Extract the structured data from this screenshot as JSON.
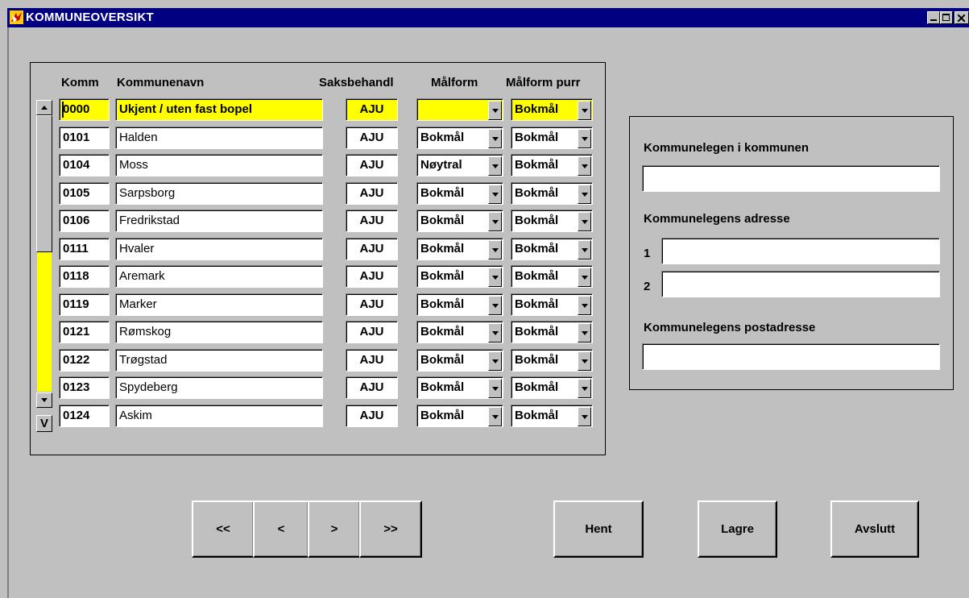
{
  "window": {
    "title": "KOMMUNEOVERSIKT",
    "icon": "app-icon",
    "controls": [
      "minimize-icon",
      "maximize-icon",
      "close-icon"
    ]
  },
  "grid": {
    "headers": {
      "komm": "Komm",
      "kommunenavn": "Kommunenavn",
      "saksbehandl": "Saksbehandl",
      "malform": "Målform",
      "malform_purr": "Målform purr"
    },
    "rows": [
      {
        "komm": "0000",
        "navn": "Ukjent / uten fast bopel",
        "saks": "AJU",
        "malform": "",
        "purr": "Bokmål"
      },
      {
        "komm": "0101",
        "navn": "Halden",
        "saks": "AJU",
        "malform": "Bokmål",
        "purr": "Bokmål"
      },
      {
        "komm": "0104",
        "navn": "Moss",
        "saks": "AJU",
        "malform": "Nøytral",
        "purr": "Bokmål"
      },
      {
        "komm": "0105",
        "navn": "Sarpsborg",
        "saks": "AJU",
        "malform": "Bokmål",
        "purr": "Bokmål"
      },
      {
        "komm": "0106",
        "navn": "Fredrikstad",
        "saks": "AJU",
        "malform": "Bokmål",
        "purr": "Bokmål"
      },
      {
        "komm": "0111",
        "navn": "Hvaler",
        "saks": "AJU",
        "malform": "Bokmål",
        "purr": "Bokmål"
      },
      {
        "komm": "0118",
        "navn": "Aremark",
        "saks": "AJU",
        "malform": "Bokmål",
        "purr": "Bokmål"
      },
      {
        "komm": "0119",
        "navn": "Marker",
        "saks": "AJU",
        "malform": "Bokmål",
        "purr": "Bokmål"
      },
      {
        "komm": "0121",
        "navn": "Rømskog",
        "saks": "AJU",
        "malform": "Bokmål",
        "purr": "Bokmål"
      },
      {
        "komm": "0122",
        "navn": "Trøgstad",
        "saks": "AJU",
        "malform": "Bokmål",
        "purr": "Bokmål"
      },
      {
        "komm": "0123",
        "navn": "Spydeberg",
        "saks": "AJU",
        "malform": "Bokmål",
        "purr": "Bokmål"
      },
      {
        "komm": "0124",
        "navn": "Askim",
        "saks": "AJU",
        "malform": "Bokmål",
        "purr": "Bokmål"
      }
    ],
    "v_button": "V"
  },
  "details": {
    "kommunelege_label": "Kommunelegen i kommunen",
    "kommunelege_value": "",
    "adresse_label": "Kommunelegens adresse",
    "adresse_1_label": "1",
    "adresse_1_value": "",
    "adresse_2_label": "2",
    "adresse_2_value": "",
    "postadresse_label": "Kommunelegens postadresse",
    "postadresse_value": ""
  },
  "nav": {
    "first": "<<",
    "prev": "<",
    "next": ">",
    "last": ">>"
  },
  "actions": {
    "hent": "Hent",
    "lagre": "Lagre",
    "avslutt": "Avslutt"
  },
  "colors": {
    "titlebar": "#000080",
    "current_record": "#ffff00",
    "face": "#c0c0c0"
  }
}
